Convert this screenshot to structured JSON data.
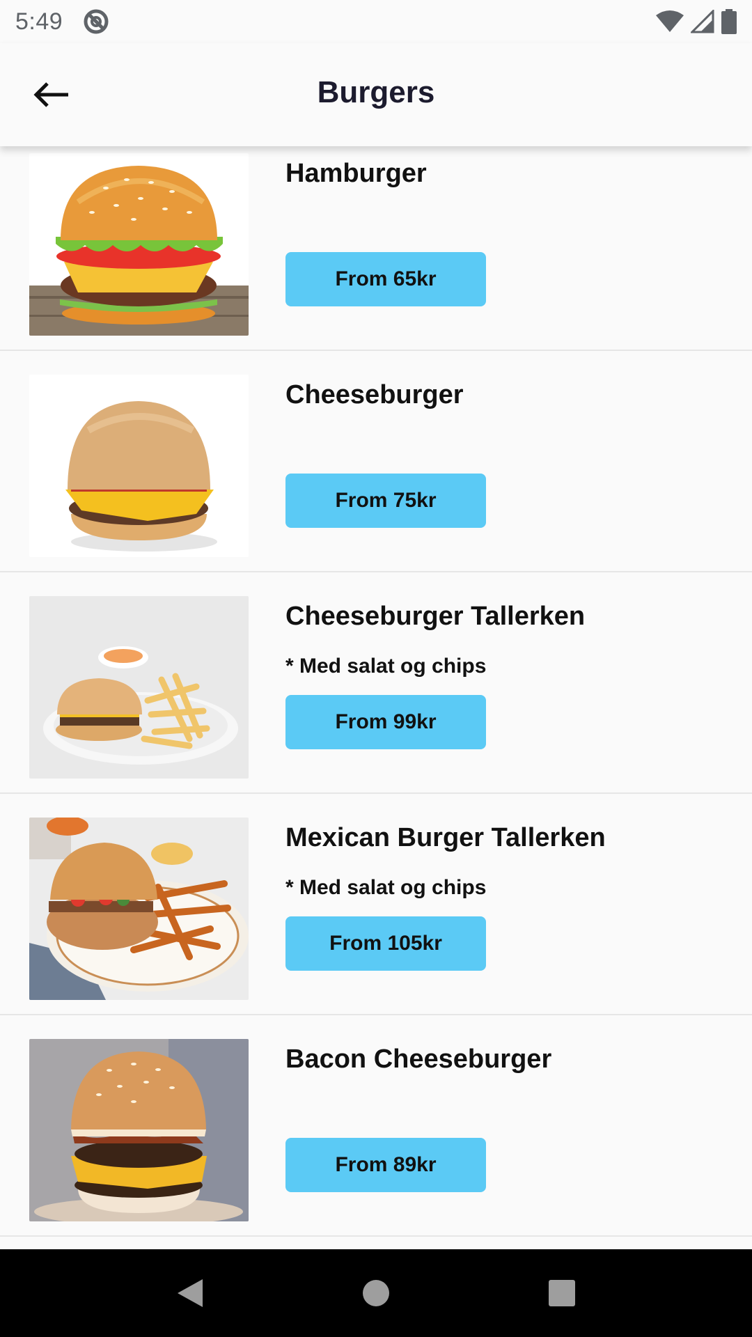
{
  "status_bar": {
    "time": "5:49",
    "icons": [
      "do-not-disturb-icon",
      "wifi-icon",
      "signal-icon",
      "battery-icon"
    ]
  },
  "app_bar": {
    "title": "Burgers",
    "back_icon": "arrow-left-icon"
  },
  "items": [
    {
      "name": "Hamburger",
      "subtitle": "",
      "price": "From 65kr",
      "image": "hamburger-photo"
    },
    {
      "name": "Cheeseburger",
      "subtitle": "",
      "price": "From 75kr",
      "image": "cheeseburger-photo"
    },
    {
      "name": "Cheeseburger Tallerken",
      "subtitle": "* Med salat og chips",
      "price": "From 99kr",
      "image": "cheeseburger-plate-photo"
    },
    {
      "name": "Mexican Burger Tallerken",
      "subtitle": "* Med salat og chips",
      "price": "From 105kr",
      "image": "mexican-burger-plate-photo"
    },
    {
      "name": "Bacon Cheeseburger",
      "subtitle": "",
      "price": "From 89kr",
      "image": "bacon-cheeseburger-photo"
    }
  ],
  "nav_bar": {
    "icons": [
      "back-triangle-icon",
      "home-circle-icon",
      "recents-square-icon"
    ]
  },
  "colors": {
    "price_button": "#5bcaf5",
    "background": "#fafafa",
    "title": "#1c1b2e"
  }
}
